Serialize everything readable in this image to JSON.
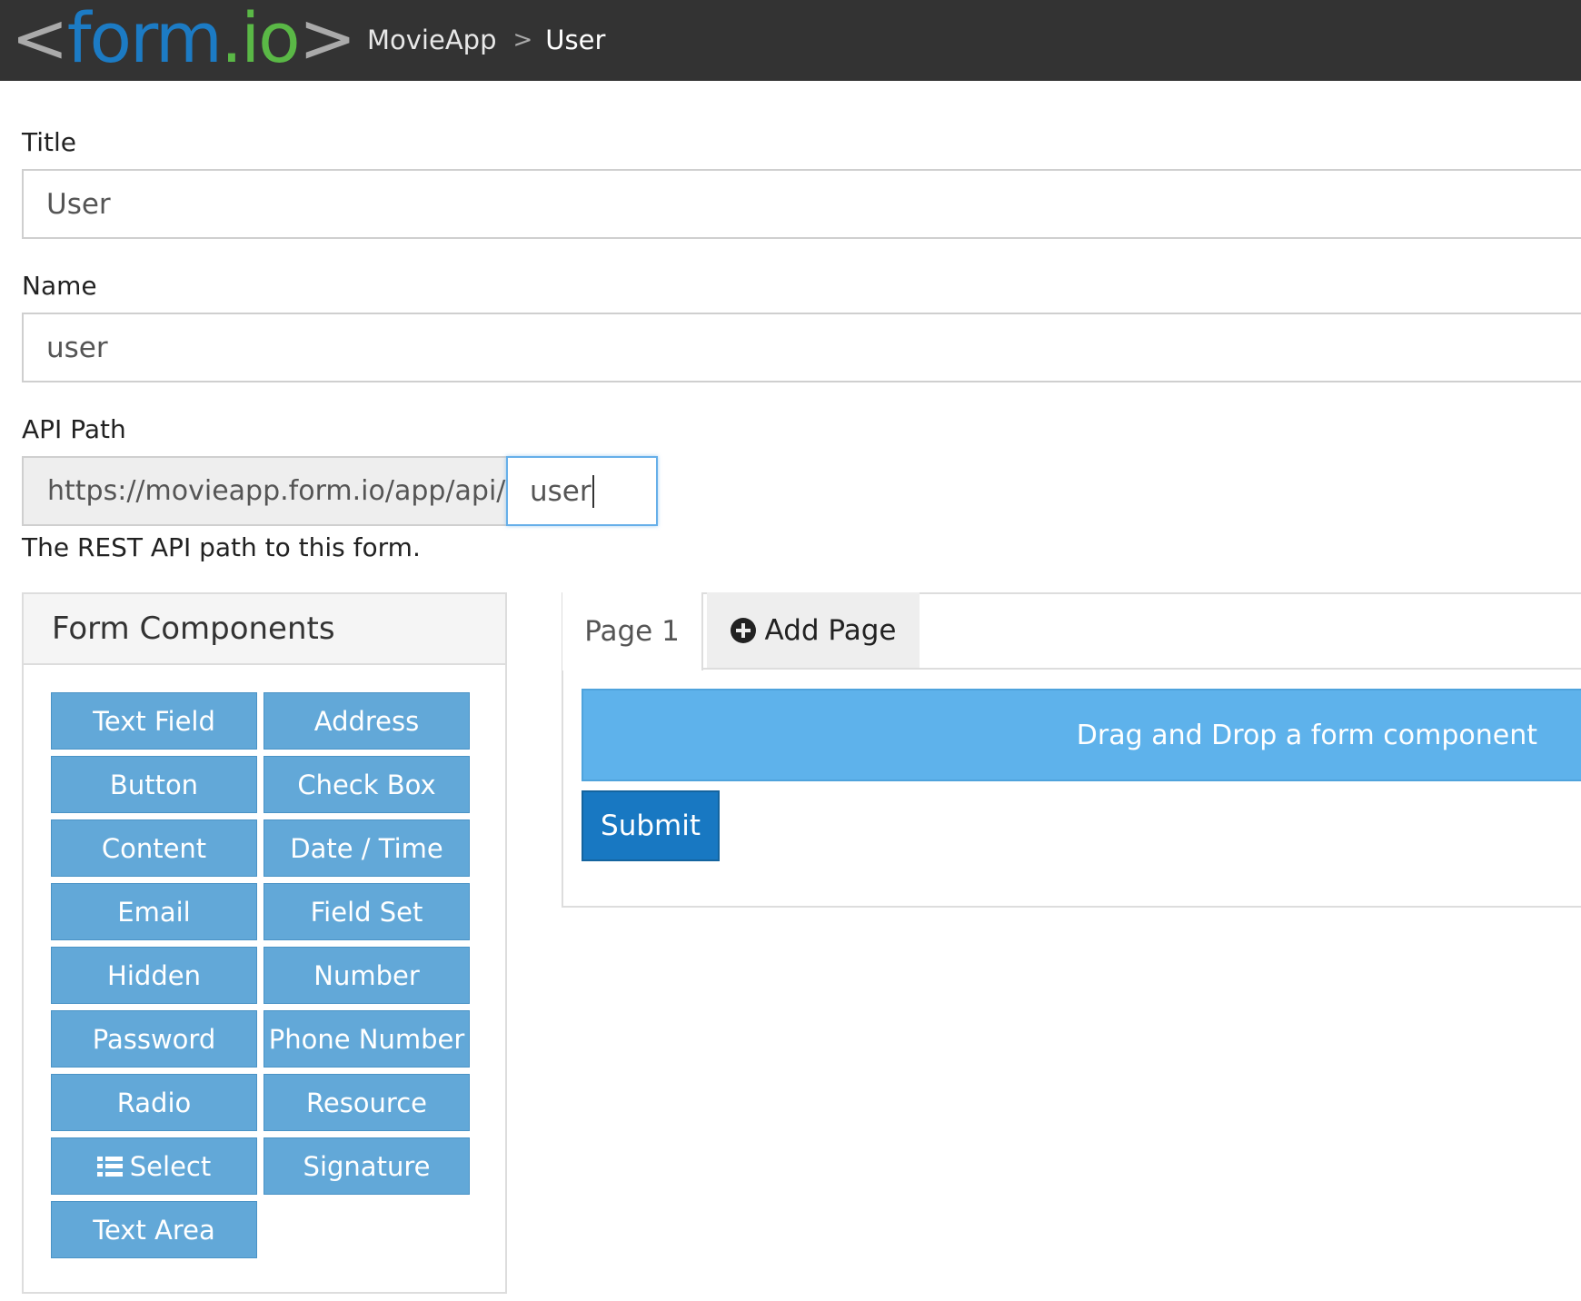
{
  "navbar": {
    "logo": {
      "open": "<",
      "form": "form",
      "dot": ".",
      "io": "io",
      "close": ">"
    },
    "breadcrumb": {
      "app": "MovieApp",
      "separator": ">",
      "current": "User"
    },
    "colors": {
      "background": "#333333",
      "logo_blue": "#1c7bc4",
      "logo_green": "#5ab846"
    }
  },
  "form": {
    "title_label": "Title",
    "title_value": "User",
    "name_label": "Name",
    "name_value": "user",
    "api_path_label": "API Path",
    "api_path_prefix": "https://movieapp.form.io/app/api/",
    "api_path_value": "user",
    "api_path_help": "The REST API path to this form."
  },
  "components_panel": {
    "heading": "Form Components",
    "buttons": [
      "Text Field",
      "Address",
      "Button",
      "Check Box",
      "Content",
      "Date / Time",
      "Email",
      "Field Set",
      "Hidden",
      "Number",
      "Password",
      "Phone Number",
      "Radio",
      "Resource",
      "Select",
      "Signature",
      "Text Area"
    ],
    "button_color": "#62a8d8"
  },
  "builder": {
    "tabs": [
      {
        "label": "Page 1",
        "active": true
      },
      {
        "label": "Add Page",
        "icon": "plus-circle-icon"
      }
    ],
    "dropzone_text": "Drag and Drop a form component",
    "dropzone_color": "#5eb2eb",
    "submit_label": "Submit",
    "submit_color": "#1878c2"
  }
}
